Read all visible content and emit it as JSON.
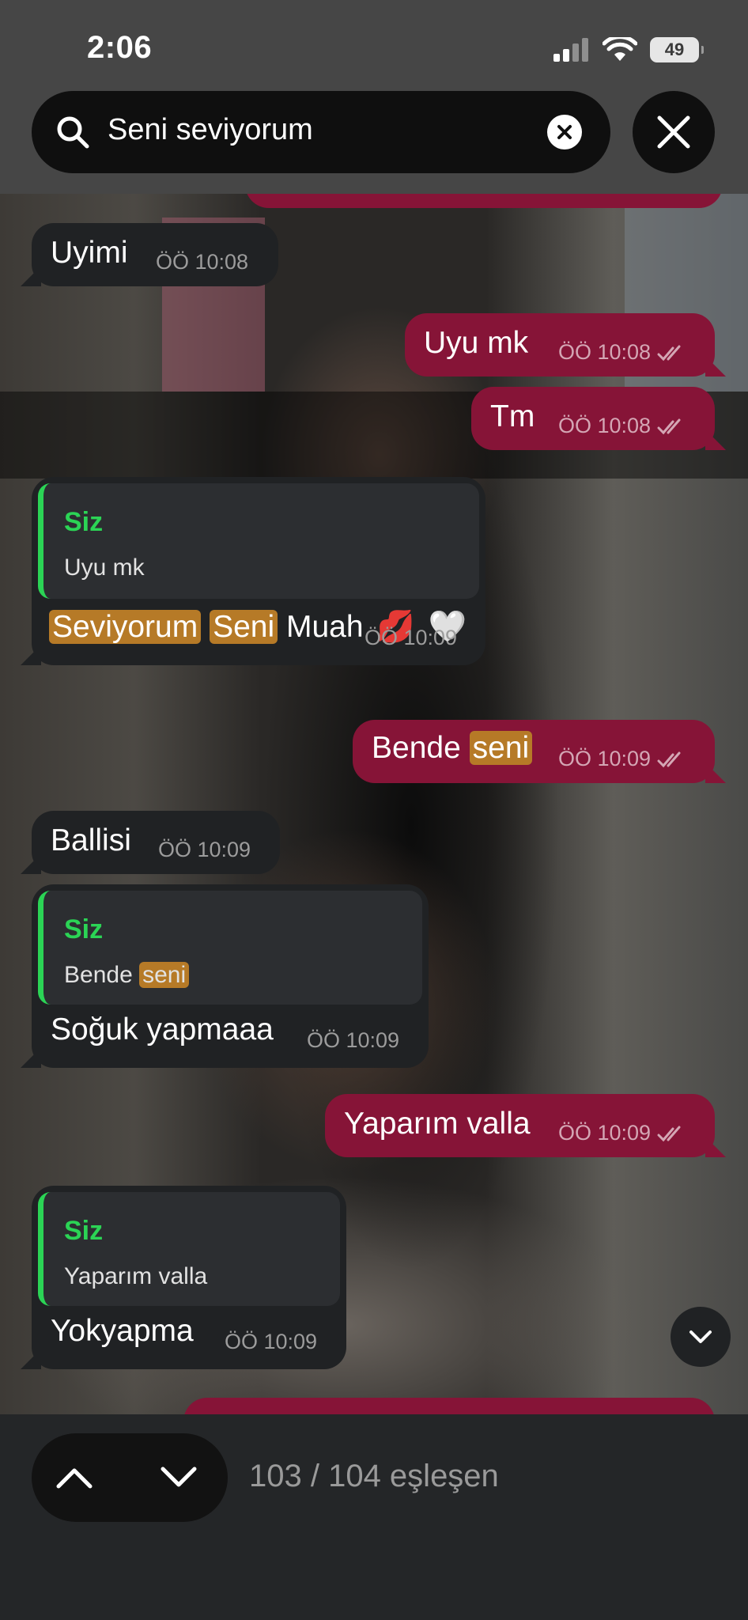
{
  "status_bar": {
    "time": "2:06",
    "battery": "49"
  },
  "search": {
    "query": "Seni seviyorum"
  },
  "messages": [
    {
      "text": "Uyimi",
      "time": "ÖÖ 10:08"
    },
    {
      "text": "Uyu mk",
      "time": "ÖÖ 10:08"
    },
    {
      "text": "Tm",
      "time": "ÖÖ 10:08"
    },
    {
      "quote_name": "Siz",
      "quote_text": "Uyu mk",
      "parts": [
        "Seviyorum",
        "Seni",
        "Muah",
        "💋",
        "🤍"
      ],
      "time": "ÖÖ 10:09"
    },
    {
      "parts": [
        "Bende",
        "seni"
      ],
      "time": "ÖÖ 10:09"
    },
    {
      "text": "Ballisi",
      "time": "ÖÖ 10:09"
    },
    {
      "quote_name": "Siz",
      "quote_parts": [
        "Bende",
        "seni"
      ],
      "text": "Soğuk yapmaaa",
      "time": "ÖÖ 10:09"
    },
    {
      "text": "Yaparım valla",
      "time": "ÖÖ 10:09"
    },
    {
      "quote_name": "Siz",
      "quote_text": "Yaparım valla",
      "text": "Yokyapma",
      "time": "ÖÖ 10:09"
    }
  ],
  "footer": {
    "match_count": "103 / 104 eşleşen"
  },
  "colors": {
    "outgoing": "#861437",
    "incoming": "#202224",
    "highlight": "#b67a27",
    "quote_accent": "#2bd455"
  },
  "icons": [
    "search-icon",
    "clear-icon",
    "close-icon",
    "double-check-icon",
    "chevron-up-icon",
    "chevron-down-icon"
  ]
}
